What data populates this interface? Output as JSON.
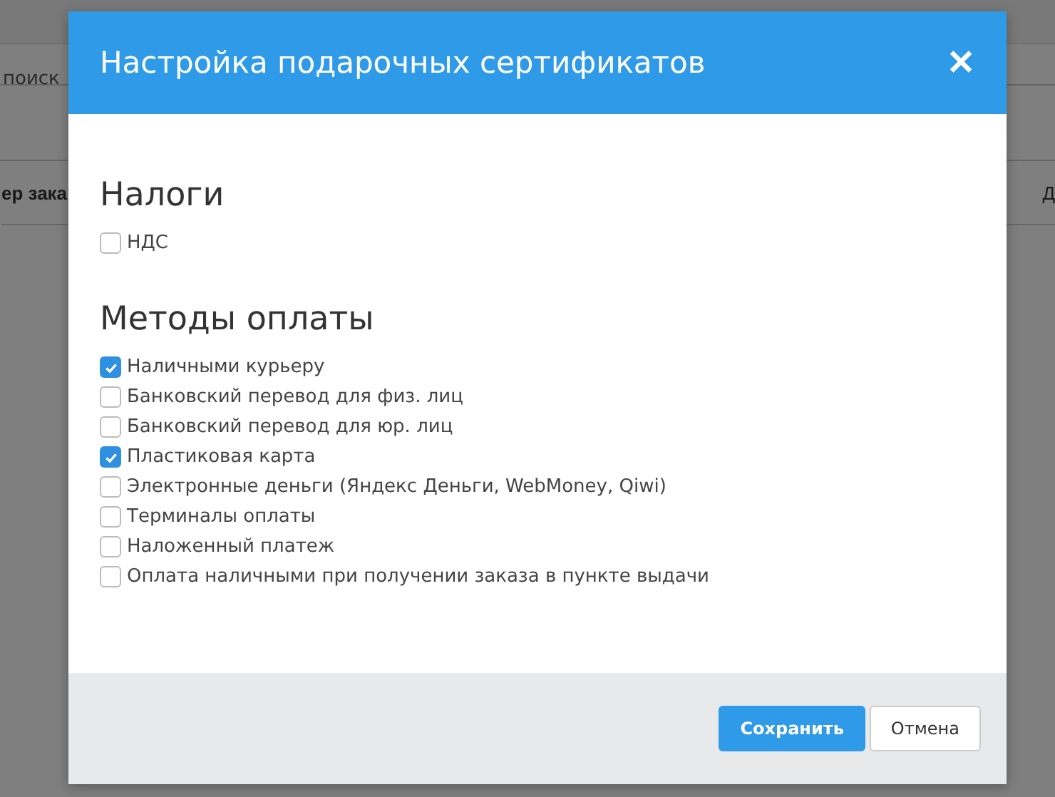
{
  "background": {
    "search_placeholder": "поиск",
    "columns": [
      "ер зака",
      "Д"
    ]
  },
  "dialog": {
    "title": "Настройка подарочных сертификатов",
    "close": "✕",
    "sections": [
      {
        "heading": "Налоги",
        "options": [
          {
            "label": "НДС",
            "checked": false
          }
        ]
      },
      {
        "heading": "Методы оплаты",
        "options": [
          {
            "label": "Наличными курьеру",
            "checked": true
          },
          {
            "label": "Банковский перевод для физ. лиц",
            "checked": false
          },
          {
            "label": "Банковский перевод для юр. лиц",
            "checked": false
          },
          {
            "label": "Пластиковая карта",
            "checked": true
          },
          {
            "label": "Электронные деньги (Яндекс Деньги, WebMoney, Qiwi)",
            "checked": false
          },
          {
            "label": "Терминалы оплаты",
            "checked": false
          },
          {
            "label": "Наложенный платеж",
            "checked": false
          },
          {
            "label": "Оплата наличными при получении заказа в пункте выдачи",
            "checked": false
          }
        ]
      }
    ],
    "buttons": [
      {
        "label": "Сохранить",
        "kind": "primary"
      },
      {
        "label": "Отмена",
        "kind": "secondary"
      }
    ]
  }
}
